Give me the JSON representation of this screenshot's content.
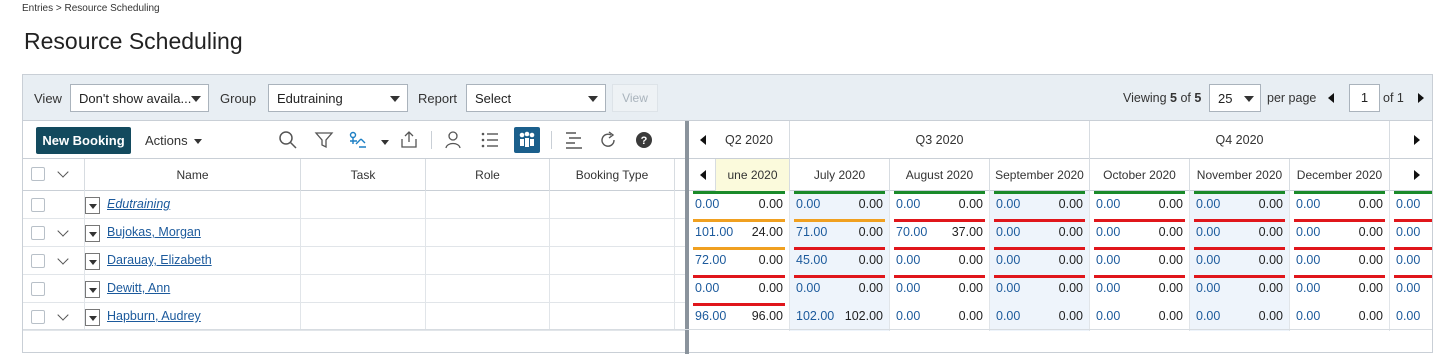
{
  "breadcrumb": "Entries > Resource Scheduling",
  "page_title": "Resource Scheduling",
  "colors": {
    "accent": "#134a5e",
    "link": "#1c5a9c",
    "bar_green": "#1a8a2a",
    "bar_orange": "#f0a020",
    "bar_red": "#e0161b",
    "toolbar_bg": "#e8eef3"
  },
  "toolbar": {
    "view_label": "View",
    "view_value": "Don't show availa...",
    "group_label": "Group",
    "group_value": "Edutraining",
    "report_label": "Report",
    "report_value": "Select",
    "view_button": "View",
    "viewing_prefix": "Viewing",
    "viewing_count": "5",
    "viewing_of": "of",
    "viewing_total": "5",
    "per_page_value": "25",
    "per_page_label": "per page",
    "page_value": "1",
    "of_pages": "of 1"
  },
  "actionbar": {
    "new_booking": "New Booking",
    "actions": "Actions",
    "icons": [
      "search-icon",
      "filter-icon",
      "assign-icon",
      "export-icon",
      "user-lookup-icon",
      "list-view-icon",
      "org-chart-icon",
      "gantt-icon",
      "refresh-icon",
      "help-icon"
    ]
  },
  "columns": {
    "name": "Name",
    "task": "Task",
    "role": "Role",
    "booking_type": "Booking Type"
  },
  "quarters": [
    "Q2 2020",
    "Q3 2020",
    "Q4 2020"
  ],
  "months": [
    "une 2020",
    "July 2020",
    "August 2020",
    "September 2020",
    "October 2020",
    "November 2020",
    "December 2020"
  ],
  "rows": [
    {
      "name": "Edutraining",
      "italic": true,
      "expandable": false,
      "cells": [
        [
          "0.00",
          "0.00",
          "green"
        ],
        [
          "0.00",
          "0.00",
          "green"
        ],
        [
          "0.00",
          "0.00",
          "green"
        ],
        [
          "0.00",
          "0.00",
          "green"
        ],
        [
          "0.00",
          "0.00",
          "green"
        ],
        [
          "0.00",
          "0.00",
          "green"
        ],
        [
          "0.00",
          "0.00",
          "green"
        ],
        [
          "0.00",
          "",
          "green"
        ]
      ]
    },
    {
      "name": "Bujokas, Morgan",
      "italic": false,
      "expandable": true,
      "cells": [
        [
          "101.00",
          "24.00",
          "orange"
        ],
        [
          "71.00",
          "0.00",
          "orange"
        ],
        [
          "70.00",
          "37.00",
          "red"
        ],
        [
          "0.00",
          "0.00",
          "red"
        ],
        [
          "0.00",
          "0.00",
          "red"
        ],
        [
          "0.00",
          "0.00",
          "red"
        ],
        [
          "0.00",
          "0.00",
          "red"
        ],
        [
          "0.00",
          "",
          "red"
        ]
      ]
    },
    {
      "name": "Darauay, Elizabeth",
      "italic": false,
      "expandable": true,
      "cells": [
        [
          "72.00",
          "0.00",
          "orange"
        ],
        [
          "45.00",
          "0.00",
          "red"
        ],
        [
          "0.00",
          "0.00",
          "red"
        ],
        [
          "0.00",
          "0.00",
          "red"
        ],
        [
          "0.00",
          "0.00",
          "red"
        ],
        [
          "0.00",
          "0.00",
          "red"
        ],
        [
          "0.00",
          "0.00",
          "red"
        ],
        [
          "0.00",
          "",
          "red"
        ]
      ]
    },
    {
      "name": "Dewitt, Ann",
      "italic": false,
      "expandable": false,
      "cells": [
        [
          "0.00",
          "0.00",
          "red"
        ],
        [
          "0.00",
          "0.00",
          "red"
        ],
        [
          "0.00",
          "0.00",
          "red"
        ],
        [
          "0.00",
          "0.00",
          "red"
        ],
        [
          "0.00",
          "0.00",
          "red"
        ],
        [
          "0.00",
          "0.00",
          "red"
        ],
        [
          "0.00",
          "0.00",
          "red"
        ],
        [
          "0.00",
          "",
          "red"
        ]
      ]
    },
    {
      "name": "Hapburn, Audrey",
      "italic": false,
      "expandable": true,
      "cells": [
        [
          "96.00",
          "96.00",
          "red"
        ],
        [
          "102.00",
          "102.00",
          "none"
        ],
        [
          "0.00",
          "0.00",
          "none"
        ],
        [
          "0.00",
          "0.00",
          "none"
        ],
        [
          "0.00",
          "0.00",
          "none"
        ],
        [
          "0.00",
          "0.00",
          "none"
        ],
        [
          "0.00",
          "0.00",
          "none"
        ],
        [
          "0.00",
          "",
          "none"
        ]
      ]
    }
  ]
}
